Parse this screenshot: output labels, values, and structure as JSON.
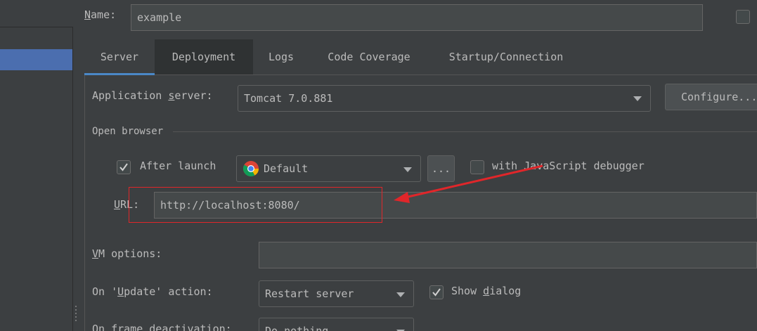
{
  "name": {
    "label": "Name:",
    "value": "example"
  },
  "tabs": [
    {
      "label": "Server"
    },
    {
      "label": "Deployment"
    },
    {
      "label": "Logs"
    },
    {
      "label": "Code Coverage"
    },
    {
      "label": "Startup/Connection"
    }
  ],
  "app_server": {
    "label": "Application server:",
    "value": "Tomcat 7.0.881",
    "configure_label": "Configure..."
  },
  "open_browser": {
    "section_label": "Open browser",
    "after_launch_label": "After launch",
    "after_launch_checked": true,
    "browser": "Default",
    "more_label": "...",
    "js_debugger_label": "with JavaScript debugger",
    "js_debugger_checked": false,
    "url_label": "URL:",
    "url_value": "http://localhost:8080/"
  },
  "vm_options": {
    "label": "VM options:",
    "value": ""
  },
  "update_action": {
    "label": "On 'Update' action:",
    "value": "Restart server",
    "show_dialog_label": "Show dialog",
    "show_dialog_checked": true
  },
  "frame_deactivation": {
    "label": "On frame deactivation:",
    "value": "Do nothing"
  },
  "colors": {
    "annotation": "#e0262a",
    "sidebar_selected": "#4b6eaf",
    "tab_selected_underline": "#4a88c7"
  }
}
